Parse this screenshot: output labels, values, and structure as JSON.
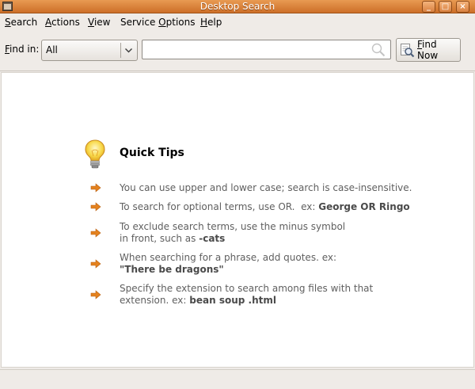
{
  "window": {
    "title": "Desktop Search",
    "buttons": [
      "_",
      "□",
      "×"
    ]
  },
  "menubar": {
    "items": [
      {
        "u": "S",
        "rest": "earch"
      },
      {
        "u": "A",
        "rest": "ctions"
      },
      {
        "u": "V",
        "rest": "iew"
      },
      {
        "pre": "Service ",
        "u": "O",
        "rest": "ptions"
      },
      {
        "u": "H",
        "rest": "elp"
      }
    ]
  },
  "toolbar": {
    "findin_label_u": "F",
    "findin_label_rest": "ind in:",
    "scope_value": "All",
    "search_value": "",
    "find_now_u": "F",
    "find_now_rest": "ind Now"
  },
  "tips": {
    "title": "Quick Tips",
    "items": [
      {
        "line1": "You can use upper and lower case; search is case-insensitive.",
        "bold1": "",
        "line2": "",
        "bold2": ""
      },
      {
        "line1": "To search for optional terms, use OR.  ex: ",
        "bold1": "George OR Ringo",
        "line2": "",
        "bold2": ""
      },
      {
        "line1": "To exclude search terms, use the minus symbol",
        "bold1": "",
        "line2": "in front, such as ",
        "bold2": "-cats"
      },
      {
        "line1": "When searching for a phrase, add quotes. ex:",
        "bold1": "",
        "line2": "",
        "bold2": "\"There be dragons\""
      },
      {
        "line1": "Specify the extension to search among files with that",
        "bold1": "",
        "line2": "extension. ex: ",
        "bold2": "bean soup .html"
      }
    ]
  },
  "colors": {
    "titlebar": "#cd6f28",
    "arrow": "#e4821f",
    "tip_text": "#5f5f5f"
  },
  "icons": {
    "app": "app-window-icon",
    "scope_arrow": "chevron-down-icon",
    "search": "magnifier-icon",
    "find": "find-document-icon",
    "tips": "lightbulb-icon",
    "bullet": "arrow-right-icon"
  }
}
